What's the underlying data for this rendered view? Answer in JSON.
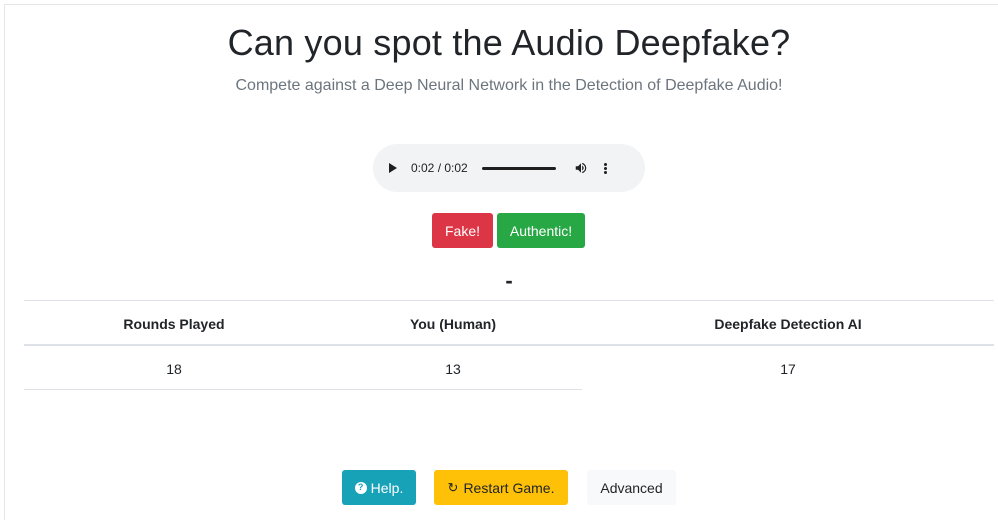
{
  "header": {
    "title": "Can you spot the Audio Deepfake?",
    "subtitle": "Compete against a Deep Neural Network in the Detection of Deepfake Audio!"
  },
  "audio_player": {
    "time": "0:02 / 0:02",
    "progress": 1.0,
    "play_icon": "play-icon",
    "volume_icon": "volume-icon",
    "more_icon": "more-options-icon"
  },
  "answer_buttons": {
    "fake_label": "Fake!",
    "authentic_label": "Authentic!"
  },
  "result_text": "-",
  "scoreboard": {
    "headers": [
      "Rounds Played",
      "You (Human)",
      "Deepfake Detection AI"
    ],
    "values": [
      "18",
      "13",
      "17"
    ]
  },
  "footer": {
    "help_label": "Help.",
    "restart_label": "Restart Game.",
    "advanced_label": "Advanced",
    "help_icon": "question-circle-icon",
    "restart_icon": "refresh-icon"
  },
  "colors": {
    "fake": "#dc3545",
    "authentic": "#28a745",
    "help": "#17a2b8",
    "restart": "#ffc107",
    "advanced": "#f8f9fa"
  }
}
